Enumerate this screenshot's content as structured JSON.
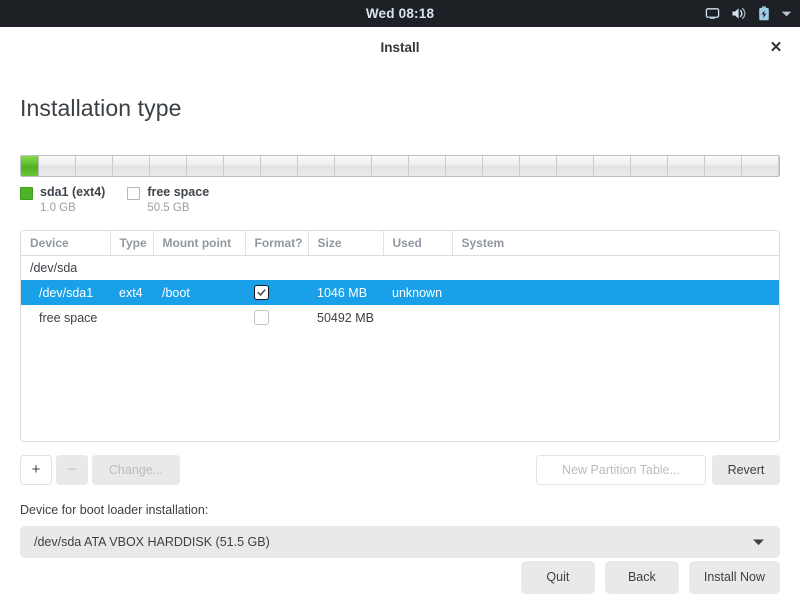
{
  "topbar": {
    "clock": "Wed 08:18",
    "icons": [
      {
        "name": "display-icon",
        "glyph": "monitor"
      },
      {
        "name": "volume-icon",
        "glyph": "speaker"
      },
      {
        "name": "battery-charging-icon",
        "glyph": "battery"
      },
      {
        "name": "system-menu-chevron-icon",
        "glyph": "chevron-down"
      }
    ]
  },
  "window": {
    "title": "Install",
    "close_label": "✕"
  },
  "page": {
    "title": "Installation type"
  },
  "usage": {
    "used_percent": 2,
    "segments": [
      {
        "name": "sda1",
        "label": "sda1 (ext4)",
        "size": "1.0 GB",
        "color": "#4cb424",
        "kind": "used"
      },
      {
        "name": "free",
        "label": "free space",
        "size": "50.5 GB",
        "color": "#fdfdfd",
        "kind": "free"
      }
    ]
  },
  "table": {
    "columns": [
      "Device",
      "Type",
      "Mount point",
      "Format?",
      "Size",
      "Used",
      "System"
    ],
    "rows": [
      {
        "kind": "disk",
        "device": "/dev/sda",
        "type": "",
        "mount_point": "",
        "format": null,
        "size": "",
        "used": "",
        "system": "",
        "selected": false
      },
      {
        "kind": "partition",
        "device": "/dev/sda1",
        "type": "ext4",
        "mount_point": "/boot",
        "format": true,
        "size": "1046 MB",
        "used": "unknown",
        "system": "",
        "selected": true
      },
      {
        "kind": "freespace",
        "device": "free space",
        "type": "",
        "mount_point": "",
        "format": false,
        "size": "50492 MB",
        "used": "",
        "system": "",
        "selected": false
      }
    ]
  },
  "actions": {
    "add_label": "+",
    "remove_label": "−",
    "change_label": "Change...",
    "new_partition_table_label": "New Partition Table...",
    "revert_label": "Revert"
  },
  "bootloader": {
    "label": "Device for boot loader installation:",
    "selected": "/dev/sda   ATA VBOX HARDDISK (51.5 GB)"
  },
  "footer": {
    "quit_label": "Quit",
    "back_label": "Back",
    "install_label": "Install Now"
  },
  "colors": {
    "accent_selection": "#19a0e8",
    "used_green": "#4cb424",
    "topbar_bg": "#1d2024",
    "button_bg": "#e9e9e9"
  }
}
